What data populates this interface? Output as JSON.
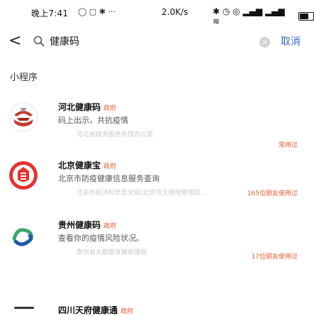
{
  "status_bar": {
    "time": "晚上7:41",
    "left_icons": "◯ ▢ ✱ ···",
    "net_speed": "2.0K/s",
    "right_icons": "✱ ⏰ ◎ ᵇᵃᵗ ⁴⁶ ᵃᵗᵗ ≋"
  },
  "search": {
    "query": "健康码",
    "clear_symbol": "×",
    "cancel_label": "取消",
    "back_symbol": "<"
  },
  "section": {
    "label": "小程序"
  },
  "results": [
    {
      "name": "河北健康码",
      "tag": "政府",
      "description": "码上出示，共抗疫情",
      "provider": "河北省政务服务管理办公室",
      "usage": "常用过"
    },
    {
      "name": "北京健康宝",
      "tag": "政府",
      "description": "北京市防疫健康信息服务查询",
      "provider": "北京市经济和信息化局(北京市无线电管理局...",
      "usage": "165位朋友使用过"
    },
    {
      "name": "贵州健康码",
      "tag": "政府",
      "description": "查看你的疫情风险状况。",
      "provider": "贵州省大数据发展管理局",
      "usage": "17位朋友使用过"
    }
  ],
  "partial_result": {
    "name": "四川天府健康通",
    "tag": "政府"
  },
  "colors": {
    "accent_blue": "#2f66c4",
    "usage_orange": "#e25a2a",
    "hebei_red": "#c23a2b",
    "beijing_red": "#e5322d",
    "guizhou_green": "#3aa66a",
    "guizhou_blue": "#1f5aa6"
  }
}
